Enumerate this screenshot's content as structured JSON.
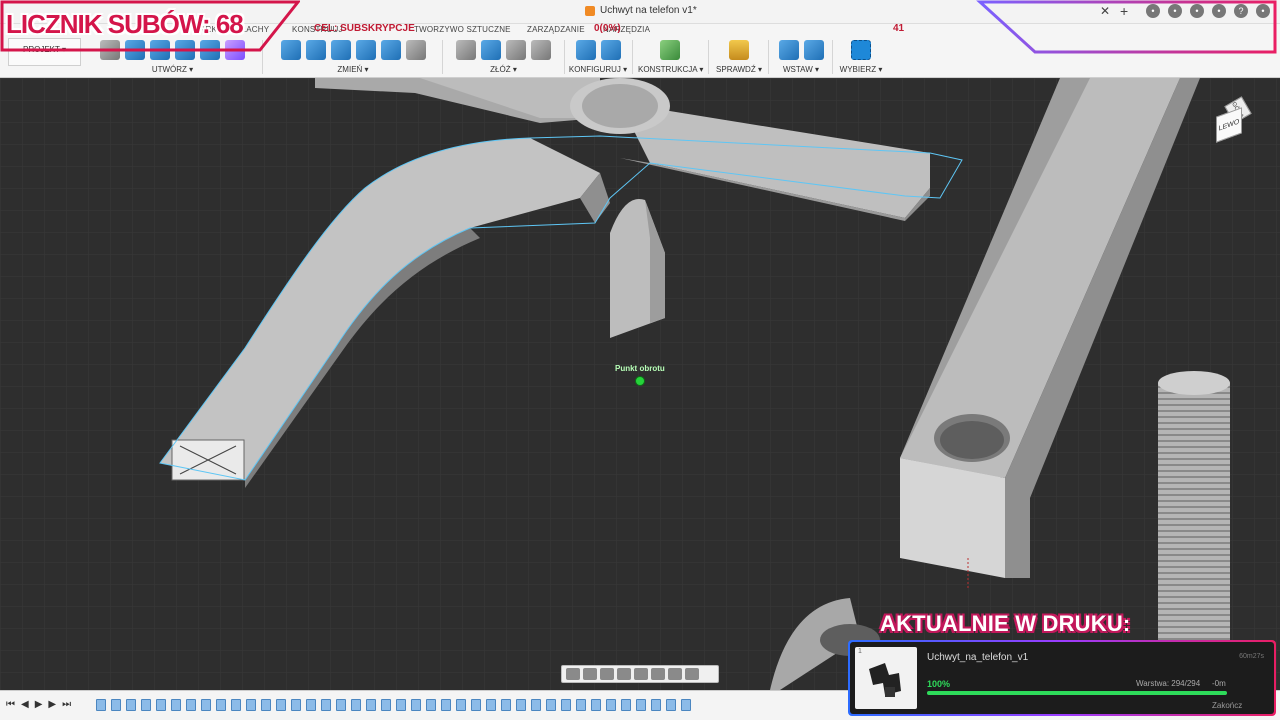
{
  "window": {
    "document_title": "Uchwyt na telefon v1*"
  },
  "ribbon": {
    "project_label": "PROJEKT",
    "tabs": [
      "KONSTRUUJ",
      "TWORZYWO SZTUCZNE",
      "ZARZĄDZANIE",
      "NARZĘDZIA",
      "ARKUSZ BLACHY"
    ],
    "groups": {
      "create": "UTWÓRZ",
      "modify": "ZMIEŃ",
      "assemble": "ZŁÓŻ",
      "configure": "KONFIGURUJ",
      "construct": "KONSTRUKCJA",
      "inspect": "SPRAWDŹ",
      "insert": "WSTAW",
      "select": "WYBIERZ"
    }
  },
  "viewport": {
    "pivot_label": "Punkt obrotu",
    "viewcube_top": "GÓRA",
    "viewcube_left": "LEWO"
  },
  "overlay": {
    "subs_counter": "LICZNIK SUBÓW: 68",
    "goal_label": "CEL: SUBSKRYPCJE",
    "goal_progress": "0(0%)",
    "goal_target": "41",
    "accent_color": "#d4154a"
  },
  "print": {
    "heading": "AKTUALNIE W DRUKU:",
    "job_number": "1",
    "file_name": "Uchwyt_na_telefon_v1",
    "elapsed": "60m27s",
    "progress_percent": 100,
    "progress_text": "100%",
    "layer_text": "Warstwa: 294/294",
    "remaining": "-0m",
    "end_label": "Zakończ"
  }
}
